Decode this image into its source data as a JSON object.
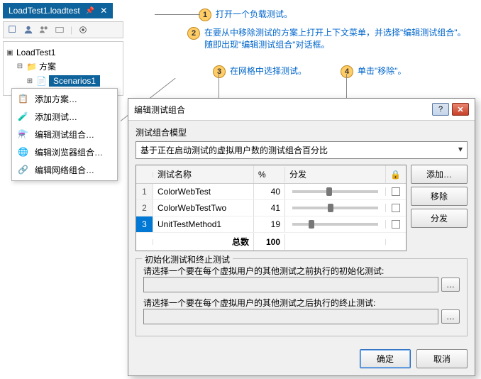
{
  "tab": {
    "title": "LoadTest1.loadtest"
  },
  "tree": {
    "root": "LoadTest1",
    "folder": "方案",
    "selected": "Scenarios1"
  },
  "context_menu": {
    "add_scenario": "添加方案…",
    "add_test": "添加测试…",
    "edit_test_mix": "编辑测试组合…",
    "edit_browser_mix": "编辑浏览器组合…",
    "edit_network_mix": "编辑网络组合…"
  },
  "callouts": {
    "c1": "打开一个负载测试。",
    "c2a": "在要从中移除测试的方案上打开上下文菜单，并选择\"编辑测试组合\"。",
    "c2b": "随即出现\"编辑测试组合\"对话框。",
    "c3": "在网格中选择测试。",
    "c4": "单击\"移除\"。"
  },
  "dialog": {
    "title": "编辑测试组合",
    "model_label": "测试组合模型",
    "model_value": "基于正在启动测试的虚拟用户数的测试组合百分比",
    "columns": {
      "name": "测试名称",
      "pct": "%",
      "dist": "分发",
      "lock": "🔒"
    },
    "rows": [
      {
        "num": "1",
        "name": "ColorWebTest",
        "pct": "40",
        "slider": 40
      },
      {
        "num": "2",
        "name": "ColorWebTestTwo",
        "pct": "41",
        "slider": 41
      },
      {
        "num": "3",
        "name": "UnitTestMethod1",
        "pct": "19",
        "slider": 19
      }
    ],
    "total_label": "总数",
    "total_value": "100",
    "buttons": {
      "add": "添加…",
      "remove": "移除",
      "distribute": "分发"
    },
    "group": {
      "title": "初始化测试和终止测试",
      "init_label": "请选择一个要在每个虚拟用户的其他测试之前执行的初始化测试:",
      "term_label": "请选择一个要在每个虚拟用户的其他测试之后执行的终止测试:"
    },
    "footer": {
      "ok": "确定",
      "cancel": "取消"
    }
  }
}
